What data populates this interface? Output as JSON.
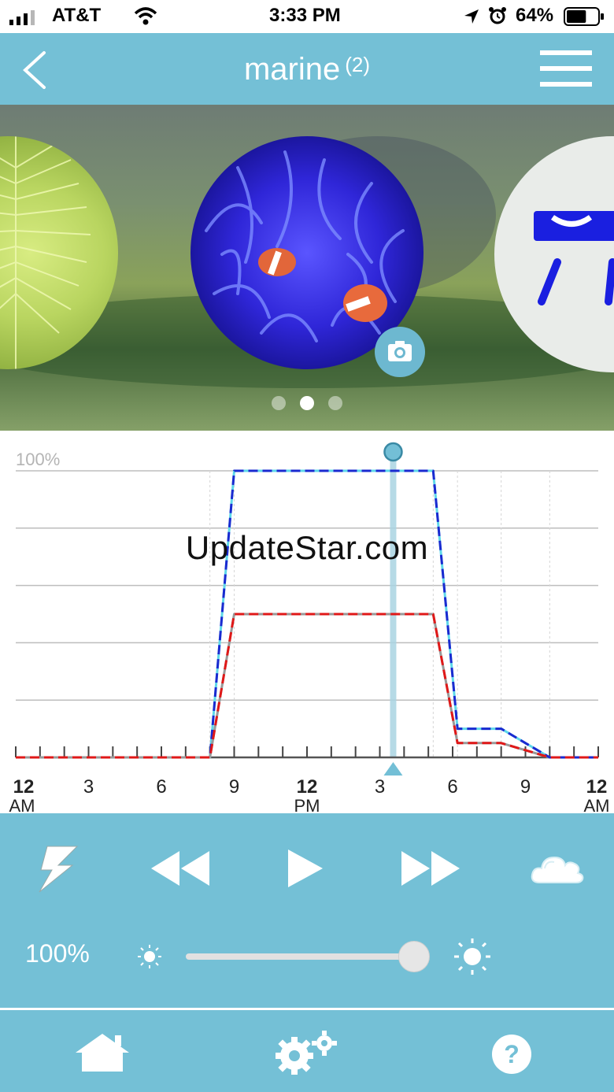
{
  "status_bar": {
    "carrier": "AT&T",
    "time": "3:33 PM",
    "battery_percent": "64%",
    "signal_level": 0.75,
    "battery_level": 0.64
  },
  "header": {
    "title": "marine",
    "count": "(2)",
    "back_icon": "chevron-left-icon",
    "menu_icon": "hamburger-icon"
  },
  "carousel": {
    "dot_count": 3,
    "active_index": 1,
    "camera_icon": "camera-icon"
  },
  "chart_data": {
    "type": "line",
    "y_top_label": "100%",
    "ylim": [
      0,
      100
    ],
    "xlim": [
      0,
      24
    ],
    "x_tick_labels": [
      {
        "h": 0,
        "line1": "12",
        "line2": "AM"
      },
      {
        "h": 3,
        "line1": "3",
        "line2": ""
      },
      {
        "h": 6,
        "line1": "6",
        "line2": ""
      },
      {
        "h": 9,
        "line1": "9",
        "line2": ""
      },
      {
        "h": 12,
        "line1": "12",
        "line2": "PM"
      },
      {
        "h": 15,
        "line1": "3",
        "line2": ""
      },
      {
        "h": 18,
        "line1": "6",
        "line2": ""
      },
      {
        "h": 21,
        "line1": "9",
        "line2": ""
      },
      {
        "h": 24,
        "line1": "12",
        "line2": "AM"
      }
    ],
    "current_time_h": 15.55,
    "series": [
      {
        "color": "#1a2ad0",
        "dash": true,
        "x": [
          0,
          8,
          9,
          17.2,
          18.2,
          20,
          22,
          24
        ],
        "y": [
          0,
          0,
          100,
          100,
          10,
          10,
          0,
          0
        ]
      },
      {
        "color": "#e01818",
        "dash": true,
        "x": [
          0,
          8,
          9,
          17.2,
          18.2,
          20,
          22,
          24
        ],
        "y": [
          0,
          0,
          50,
          50,
          5,
          5,
          0,
          0
        ]
      },
      {
        "color": "#5ed8ea",
        "dash": false,
        "x": [
          0,
          8,
          9,
          17.2,
          18.2,
          20,
          22,
          24
        ],
        "y": [
          0,
          0,
          100,
          100,
          10,
          10,
          0,
          0
        ]
      },
      {
        "color": "#999999",
        "dash": false,
        "x": [
          0,
          8,
          9,
          17.2,
          18.2,
          20,
          22,
          24
        ],
        "y": [
          0,
          0,
          50,
          50,
          5,
          5,
          0,
          0
        ]
      }
    ]
  },
  "controls": {
    "lightning_icon": "lightning-icon",
    "rewind_icon": "rewind-icon",
    "play_icon": "play-icon",
    "fast_forward_icon": "fast-forward-icon",
    "cloud_icon": "cloud-icon",
    "brightness_label": "100%",
    "brightness_level": 1.0
  },
  "bottom_nav": {
    "home_icon": "home-icon",
    "settings_icon": "gears-icon",
    "help_icon": "help-icon"
  },
  "watermark": "UpdateStar.com"
}
